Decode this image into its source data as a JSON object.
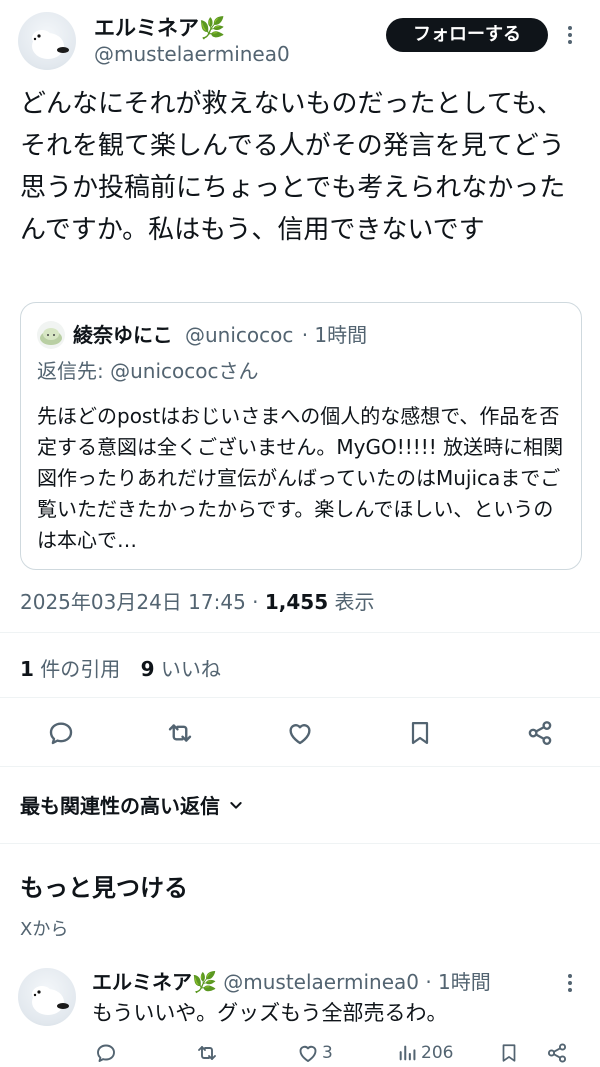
{
  "post": {
    "author_name": "エルミネア🌿",
    "author_handle": "@mustelaerminea0",
    "follow_label": "フォローする",
    "text": "どんなにそれが救えないものだったとしても、それを観て楽しんでる人がその発言を見てどう思うか投稿前にちょっとでも考えられなかったんですか。私はもう、信用できないです",
    "quote": {
      "author_name": "綾奈ゆにこ",
      "author_handle": "@unicococ",
      "time": "· 1時間",
      "reply_to": "返信先: @unicococさん",
      "text": "先ほどのpostはおじいさまへの個人的な感想で、作品を否定する意図は全くございません。MyGO!!!!! 放送時に相関図作ったりあれだけ宣伝がんばっていたのはMujicaまでご覧いただきたかったからです。楽しんでほしい、というのは本心で…"
    },
    "timestamp": "2025年03月24日 17:45 ·",
    "views_count": "1,455",
    "views_label": "表示",
    "quotes_count": "1",
    "quotes_label": "件の引用",
    "likes_count": "9",
    "likes_label": "いいね"
  },
  "actions": [
    "reply-icon",
    "retweet-icon",
    "like-icon",
    "bookmark-icon",
    "share-icon"
  ],
  "sort": {
    "label": "最も関連性の高い返信"
  },
  "discover": {
    "title": "もっと見つける",
    "source": "Xから"
  },
  "reply": {
    "author_name": "エルミネア🌿",
    "author_handle": "@mustelaerminea0",
    "time": "· 1時間",
    "text": "もういいや。グッズもう全部売るわ。",
    "likes": "3",
    "views": "206"
  },
  "colors": {
    "text": "#0f1419",
    "muted": "#536471",
    "border": "#cfd9de",
    "divider": "#eff3f4",
    "button_bg": "#0f1419"
  }
}
